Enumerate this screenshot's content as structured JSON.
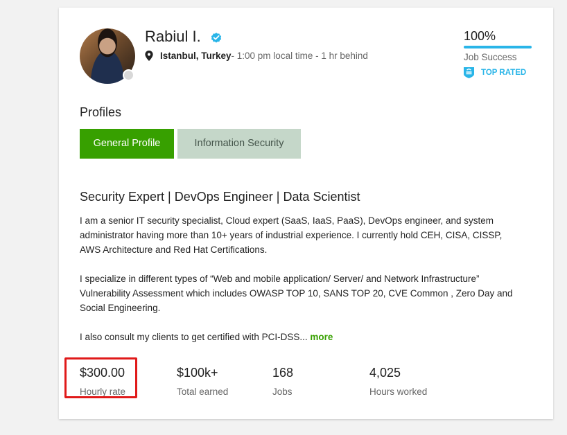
{
  "profile": {
    "name": "Rabiul I.",
    "location_city": "Istanbul, Turkey",
    "location_time": " - 1:00 pm local time - 1 hr behind",
    "online_status": "offline"
  },
  "job_success": {
    "percent_text": "100%",
    "value": 1.0,
    "label": "Job Success"
  },
  "badge": {
    "label": "TOP RATED"
  },
  "profiles": {
    "heading": "Profiles",
    "tabs": [
      {
        "label": "General Profile",
        "active": true
      },
      {
        "label": "Information Security",
        "active": false
      }
    ]
  },
  "overview": {
    "title": "Security Expert | DevOps Engineer | Data Scientist",
    "paragraphs": [
      "I am a senior IT security specialist, Cloud expert (SaaS, IaaS, PaaS), DevOps engineer, and system administrator having more than 10+ years of industrial experience. I currently hold CEH, CISA, CISSP, AWS Architecture and Red Hat Certifications.",
      "I specialize in different types of “Web and mobile application/ Server/ and Network Infrastructure” Vulnerability Assessment which includes OWASP TOP 10, SANS TOP 20, CVE Common , Zero Day and Social Engineering.",
      "I also consult my clients to get certified with PCI-DSS..."
    ],
    "more_label": "more"
  },
  "stats": [
    {
      "value": "$300.00",
      "label": "Hourly rate"
    },
    {
      "value": "$100k+",
      "label": "Total earned"
    },
    {
      "value": "168",
      "label": "Jobs"
    },
    {
      "value": "4,025",
      "label": "Hours worked"
    }
  ],
  "colors": {
    "brand_green": "#37a000",
    "accent_blue": "#29b5e8",
    "highlight_red": "#e01a1a",
    "tab_inactive_bg": "#c5d7c9"
  },
  "icons": {
    "verified": "verified-check-icon",
    "location": "map-pin-icon",
    "top_rated": "shield-badge-icon"
  }
}
